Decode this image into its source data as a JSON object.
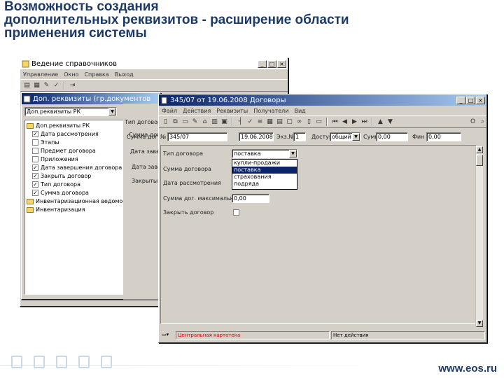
{
  "slide": {
    "title_lines": [
      "Возможность создания",
      "дополнительных реквизитов - расширение области",
      "применения системы"
    ],
    "footer_url": "www.eos.ru"
  },
  "win_refs": {
    "title": "Ведение справочников",
    "menu": [
      "Управление",
      "Окно",
      "Справка",
      "Выход"
    ]
  },
  "win_attrs": {
    "title": "Доп. реквизиты (гр.документов",
    "combo_value": "Доп.реквизиты РК",
    "tree": [
      {
        "label": "Доп.реквизиты РК",
        "checked": null,
        "folder": true
      },
      {
        "label": "Дата рассмотрения",
        "checked": true,
        "folder": false
      },
      {
        "label": "Этапы",
        "checked": false,
        "folder": false
      },
      {
        "label": "Предмет договора",
        "checked": false,
        "folder": false
      },
      {
        "label": "Приложения",
        "checked": false,
        "folder": false
      },
      {
        "label": "Дата завершения договора",
        "checked": true,
        "folder": false
      },
      {
        "label": "Закрыть договор",
        "checked": true,
        "folder": false
      },
      {
        "label": "Тип договора",
        "checked": true,
        "folder": false
      },
      {
        "label": "Сумма договора",
        "checked": true,
        "folder": false
      },
      {
        "label": "Инвентаризационная ведомость",
        "checked": null,
        "folder": true
      },
      {
        "label": "Инвентаризация",
        "checked": null,
        "folder": true
      }
    ],
    "right_labels": [
      "Тип договора",
      "Сумма дог",
      "Дата заве",
      "Дата завер",
      "Закрытый"
    ]
  },
  "win_doc": {
    "title": "345/07 от 19.06.2008 Договоры",
    "menu": [
      "Файл",
      "Действия",
      "Реквизиты",
      "Получатели",
      "Вид"
    ],
    "row": {
      "sum_label": "Сумма дог",
      "rk_label": "№",
      "rk_value": "345/07",
      "date_value": "19.06.2008",
      "copies_label": "Экз.№",
      "copies_value": "1",
      "access_label": "Доступ",
      "access_value": "общий",
      "amount_label": "Сумма",
      "amount_value": "0,00",
      "currency_label": "Фин",
      "currency_value": "0,00"
    },
    "form_labels": [
      "Тип договора",
      "Сумма договора",
      "Дата рассмотрения",
      "Сумма дог. максимальная",
      "Закрыть договор"
    ],
    "type_value": "поставка",
    "type_options": [
      "купли-продажи",
      "поставка",
      "страхования",
      "подряда"
    ],
    "type_selected": "поставка",
    "amount_field": "0,00",
    "status": [
      "Центральная картотека",
      "Нет действия"
    ]
  }
}
